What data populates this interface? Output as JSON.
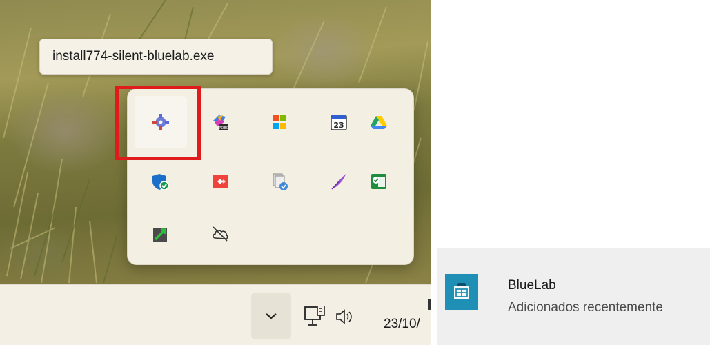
{
  "tooltip": {
    "text": "install774-silent-bluelab.exe"
  },
  "tray": {
    "icons": [
      {
        "name": "bluelab-installer-icon",
        "highlighted": true
      },
      {
        "name": "copilot-pobo-icon"
      },
      {
        "name": "microsoft-store-icon"
      },
      {
        "name": "calendar-icon",
        "label": "23"
      },
      {
        "name": "google-drive-icon"
      },
      {
        "name": "windows-security-icon"
      },
      {
        "name": "anydesk-icon"
      },
      {
        "name": "backup-restore-icon"
      },
      {
        "name": "feather-pen-icon"
      },
      {
        "name": "sheets-check-icon"
      },
      {
        "name": "green-arrow-app-icon"
      },
      {
        "name": "cloud-offline-icon"
      }
    ],
    "highlight_color": "#e01b1b"
  },
  "taskbar": {
    "date": "23/10/",
    "icons": [
      "chevron-up-icon",
      "network-icon",
      "volume-icon"
    ]
  },
  "recent_app": {
    "name": "BlueLab",
    "subtitle": "Adicionados recentemente",
    "icon_color": "#1f8fb5"
  }
}
